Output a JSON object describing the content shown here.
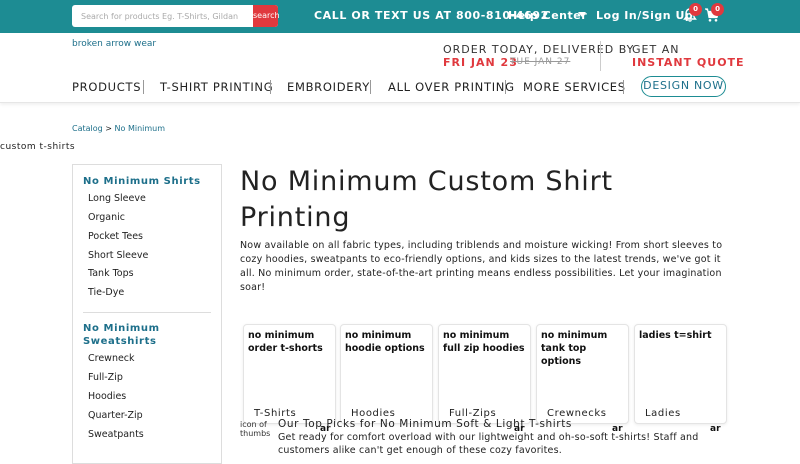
{
  "topbar": {
    "search_placeholder": "Search for products Eg. T-Shirts, Gildan",
    "search_button": "search",
    "call_text": "CALL OR TEXT US AT 800-810-4692",
    "help_label": "Help Center",
    "login_label": "Log In/Sign Up",
    "notifications_count": "0",
    "cart_count": "0",
    "accent": "#1d8c93",
    "badge_color": "#e0393e"
  },
  "header": {
    "brand_text": "broken arrow wear",
    "order_line": "ORDER TODAY, DELIVERED BY",
    "order_date": "FRI JAN 23",
    "order_old_date": "TUE JAN 27",
    "quote_line1": "GET AN",
    "quote_line2": "INSTANT QUOTE",
    "nav": [
      "PRODUCTS",
      "T-SHIRT PRINTING",
      "EMBROIDERY",
      "ALL OVER PRINTING",
      "MORE SERVICES"
    ],
    "design_button": "DESIGN NOW"
  },
  "breadcrumb": {
    "root": "Catalog",
    "sep": " > ",
    "current": "No Minimum"
  },
  "alt_text": "custom t-shirts",
  "sidebar": {
    "shirts_heading": "No Minimum Shirts",
    "shirts": [
      "Long Sleeve",
      "Organic",
      "Pocket Tees",
      "Short Sleeve",
      "Tank Tops",
      "Tie-Dye"
    ],
    "sweatshirts_heading": "No Minimum Sweatshirts",
    "sweatshirts": [
      "Crewneck",
      "Full-Zip",
      "Hoodies",
      "Quarter-Zip",
      "Sweatpants"
    ]
  },
  "main": {
    "title": "No Minimum Custom Shirt Printing",
    "description": "Now available on all fabric types, including triblends and moisture wicking! From short sleeves to cozy hoodies, sweatpants to eco-friendly options, and kids sizes to the latest trends, we've got it all. No minimum order, state-of-the-art printing means endless possibilities. Let your imagination soar!",
    "cards": [
      {
        "alt": "no minimum order t-shorts",
        "label": "T-Shirts"
      },
      {
        "alt": "no minimum hoodie options",
        "label": "Hoodies"
      },
      {
        "alt": "no minimum full zip hoodies",
        "label": "Full-Zips"
      },
      {
        "alt": "no minimum tank top options",
        "label": "Crewnecks"
      },
      {
        "alt": "ladies t=shirt",
        "label": "Ladies"
      }
    ],
    "below_icon_alt": "icon of thumbs",
    "below_title": "Our Top Picks for No Minimum Soft & Light T-shirts",
    "below_ar": "ar",
    "below_text": "Get ready for comfort overload with our lightweight and oh-so-soft t-shirts! Staff and customers alike can't get enough of these cozy favorites."
  }
}
